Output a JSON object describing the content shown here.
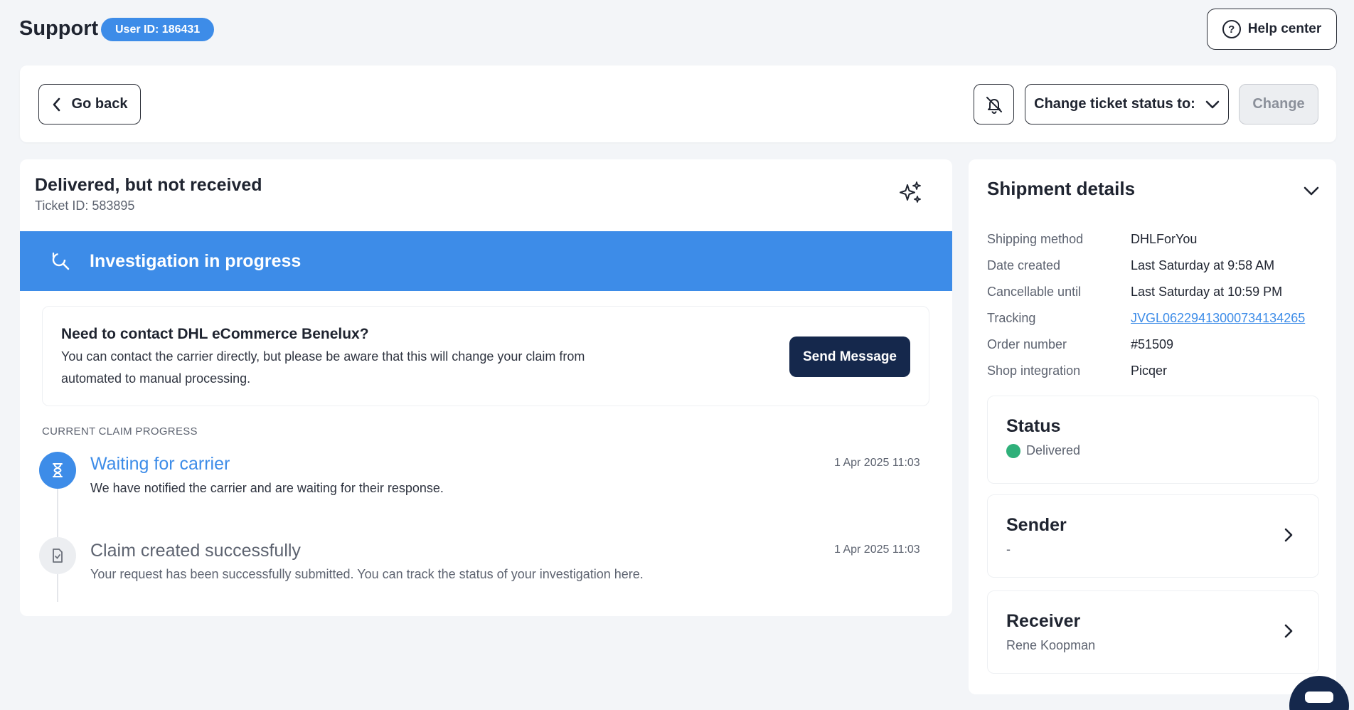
{
  "header": {
    "title": "Support",
    "user_badge": "User ID: 186431",
    "help_label": "Help center"
  },
  "toolbar": {
    "go_back_label": "Go back",
    "status_select_label": "Change ticket status to:",
    "change_label": "Change"
  },
  "ticket": {
    "title": "Delivered, but not received",
    "id_text": "Ticket ID: 583895",
    "banner_text": "Investigation in progress",
    "contact": {
      "title": "Need to contact DHL eCommerce Benelux?",
      "description": "You can contact the carrier directly, but please be aware that this will change your claim from automated to manual processing.",
      "button_label": "Send Message"
    },
    "progress_label": "CURRENT CLAIM PROGRESS",
    "timeline": [
      {
        "title": "Waiting for carrier",
        "description": "We have notified the carrier and are waiting for their response.",
        "timestamp": "1 Apr 2025 11:03",
        "state": "active"
      },
      {
        "title": "Claim created successfully",
        "description": "Your request has been successfully submitted. You can track the status of your investigation here.",
        "timestamp": "1 Apr 2025 11:03",
        "state": "done"
      }
    ]
  },
  "shipment": {
    "title": "Shipment details",
    "details": [
      {
        "label": "Shipping method",
        "value": "DHLForYou"
      },
      {
        "label": "Date created",
        "value": "Last Saturday at 9:58 AM"
      },
      {
        "label": "Cancellable until",
        "value": "Last Saturday at 10:59 PM"
      },
      {
        "label": "Tracking",
        "value": "JVGL06229413000734134265"
      },
      {
        "label": "Order number",
        "value": "#51509"
      },
      {
        "label": "Shop integration",
        "value": "Picqer"
      }
    ],
    "status": {
      "title": "Status",
      "value": "Delivered"
    },
    "sender": {
      "title": "Sender",
      "value": "-"
    },
    "receiver": {
      "title": "Receiver",
      "value": "Rene Koopman"
    }
  },
  "colors": {
    "accent": "#3d8ce8",
    "navy": "#15284c",
    "status_delivered": "#2fb07a"
  },
  "icons": [
    "question-circle-icon",
    "chevron-left-icon",
    "bell-off-icon",
    "chevron-down-icon",
    "sparkles-icon",
    "search-refresh-icon",
    "hourglass-icon",
    "document-icon",
    "chevron-right-icon",
    "chat-icon"
  ]
}
